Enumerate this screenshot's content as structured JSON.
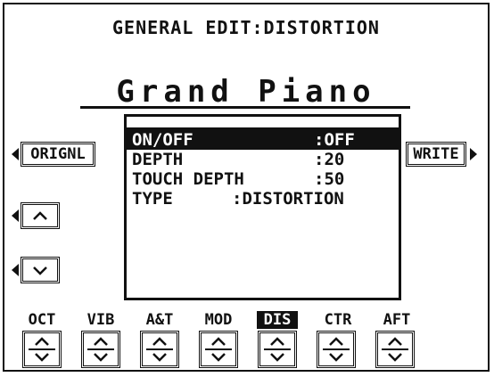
{
  "header": {
    "title": "GENERAL EDIT:DISTORTION",
    "voice": "Grand Piano"
  },
  "buttons": {
    "original": "ORIGNL",
    "write": "WRITE"
  },
  "menu": {
    "items": [
      {
        "label": "ON/OFF",
        "value": ":OFF",
        "selected": true
      },
      {
        "label": "DEPTH",
        "value": ":20"
      },
      {
        "label": "TOUCH DEPTH",
        "value": ":50"
      },
      {
        "label": "TYPE",
        "value": ":DISTORTION"
      }
    ]
  },
  "tabs": [
    {
      "label": "OCT"
    },
    {
      "label": "VIB"
    },
    {
      "label": "A&T"
    },
    {
      "label": "MOD"
    },
    {
      "label": "DIS",
      "active": true
    },
    {
      "label": "CTR"
    },
    {
      "label": "AFT"
    }
  ],
  "icons": {
    "up": "chevron-up-icon",
    "down": "chevron-down-icon",
    "left": "triangle-left-icon",
    "right": "triangle-right-icon",
    "stepper": "up-down-chevron-icon"
  }
}
